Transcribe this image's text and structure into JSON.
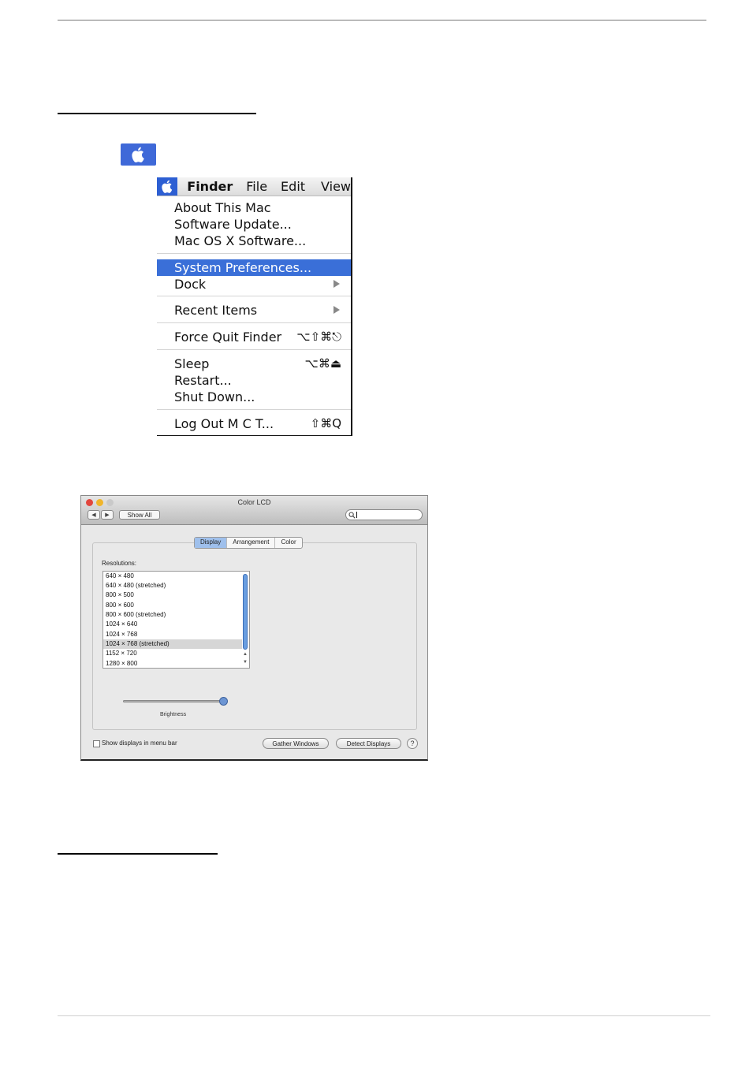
{
  "menu": {
    "bar_items": [
      "Finder",
      "File",
      "Edit",
      "View"
    ],
    "items": [
      {
        "label": "About This Mac"
      },
      {
        "label": "Software Update..."
      },
      {
        "label": "Mac OS X Software..."
      },
      {
        "label": "System Preferences...",
        "selected": true
      },
      {
        "label": "Dock",
        "submenu": true
      },
      {
        "label": "Recent Items",
        "submenu": true
      },
      {
        "label": "Force Quit Finder",
        "shortcut": "⌥⇧⌘⎋"
      },
      {
        "label": "Sleep",
        "shortcut": "⌥⌘⏏"
      },
      {
        "label": "Restart..."
      },
      {
        "label": "Shut Down..."
      },
      {
        "label": "Log Out M C T...",
        "shortcut": "⇧⌘Q"
      }
    ],
    "highlight_color": "#3a6fd8"
  },
  "window": {
    "title": "Color LCD",
    "show_all": "Show All",
    "search_placeholder": "",
    "tabs": [
      "Display",
      "Arrangement",
      "Color"
    ],
    "active_tab": "Display",
    "resolutions_label": "Resolutions:",
    "resolutions": [
      "640 × 480",
      "640 × 480 (stretched)",
      "800 × 500",
      "800 × 600",
      "800 × 600 (stretched)",
      "1024 × 640",
      "1024 × 768",
      "1024 × 768 (stretched)",
      "1152 × 720",
      "1280 × 800"
    ],
    "selected_resolution": "1024 × 768 (stretched)",
    "brightness_label": "Brightness",
    "brightness_level": 1.0,
    "show_displays_checkbox": "Show displays in menu bar",
    "show_displays_checked": false,
    "gather_windows": "Gather Windows",
    "detect_displays": "Detect Displays",
    "help": "?"
  }
}
